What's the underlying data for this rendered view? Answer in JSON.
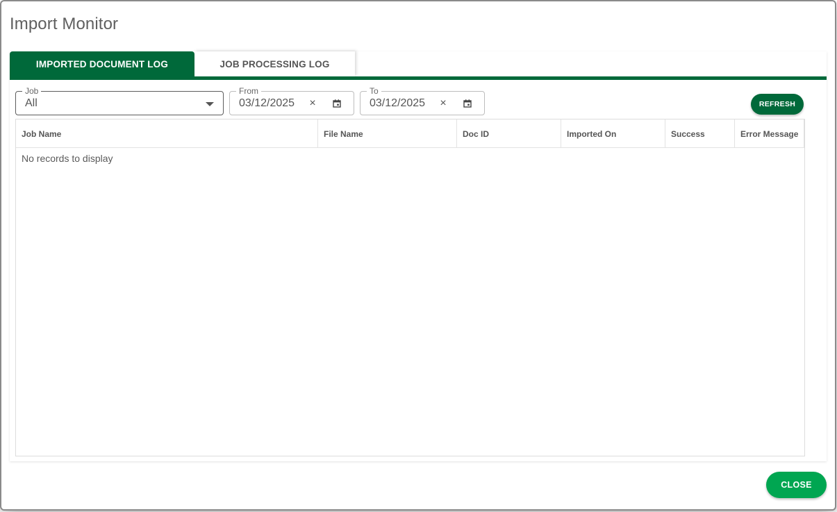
{
  "dialog": {
    "title": "Import Monitor"
  },
  "tabs": [
    {
      "label": "IMPORTED DOCUMENT LOG",
      "active": true
    },
    {
      "label": "JOB PROCESSING LOG",
      "active": false
    }
  ],
  "filters": {
    "job": {
      "label": "Job",
      "value": "All"
    },
    "from": {
      "label": "From",
      "value": "03/12/2025"
    },
    "to": {
      "label": "To",
      "value": "03/12/2025"
    },
    "clear_glyph": "×"
  },
  "refresh_label": "REFRESH",
  "grid": {
    "columns": [
      "Job Name",
      "File Name",
      "Doc ID",
      "Imported On",
      "Success",
      "Error Message"
    ],
    "empty_message": "No records to display"
  },
  "close_label": "CLOSE",
  "colors": {
    "primary_dark": "#00693a",
    "primary_bright": "#00a651"
  },
  "icons": [
    "chevron-down-icon",
    "clear-icon",
    "calendar-icon"
  ]
}
